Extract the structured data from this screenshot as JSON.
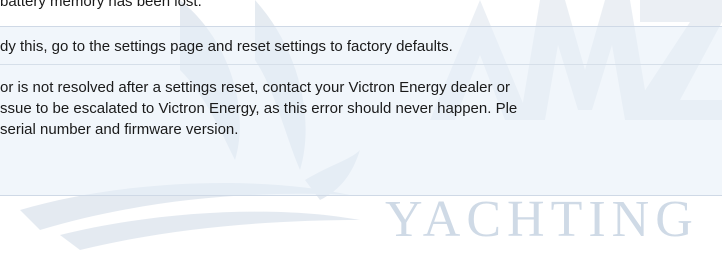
{
  "document": {
    "top_line": "battery memory has been lost.",
    "resolution_text": "dy this, go to the settings page and reset settings to factory defaults.",
    "escalation_lines": [
      "or is not resolved after a settings reset, contact your Victron Energy dealer or",
      "ssue to be escalated to Victron Energy, as this error should never happen. Ple",
      "serial number and firmware version."
    ]
  },
  "watermark": {
    "text": "YACHTING",
    "letters": "AMZ",
    "color": "#8aa3c1"
  }
}
